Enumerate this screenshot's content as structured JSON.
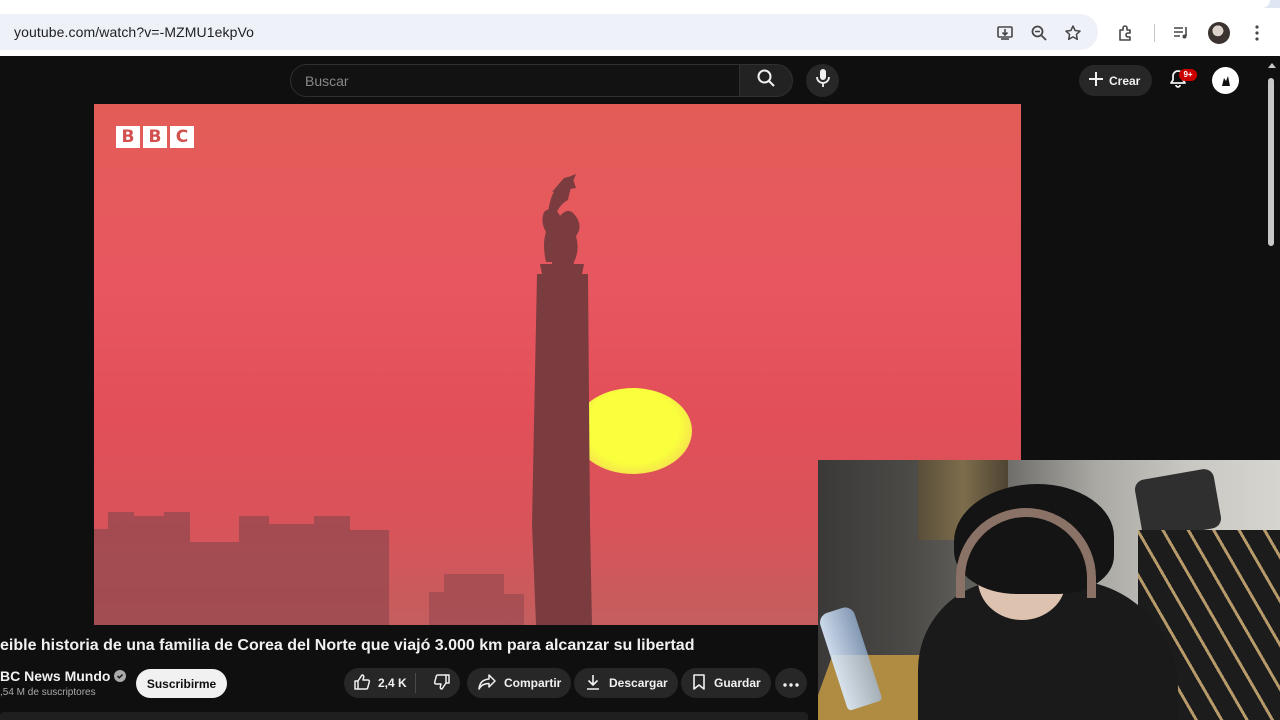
{
  "browser": {
    "url": "youtube.com/watch?v=-MZMU1ekpVo",
    "icons": [
      "install-icon",
      "zoom-icon",
      "star-icon",
      "extensions-icon",
      "media-icon",
      "profile-avatar",
      "menu-icon"
    ]
  },
  "header": {
    "search_placeholder": "Buscar",
    "create_label": "Crear",
    "notification_count": "9+"
  },
  "video": {
    "logo_letters": [
      "B",
      "B",
      "C"
    ],
    "title": "eible historia de una familia de Corea del Norte que viajó 3.000 km para alcanzar su libertad"
  },
  "channel": {
    "name": "BC News Mundo",
    "subscribers": ",54 M de suscriptores",
    "subscribe_label": "Suscribirme"
  },
  "actions": {
    "likes": "2,4 K",
    "share_label": "Compartir",
    "download_label": "Descargar",
    "save_label": "Guardar"
  },
  "colors": {
    "youtube_bg": "#0f0f0f",
    "accent_badge": "#cc0000",
    "video_sky": "#e85660",
    "sun": "#f9ff3c"
  }
}
